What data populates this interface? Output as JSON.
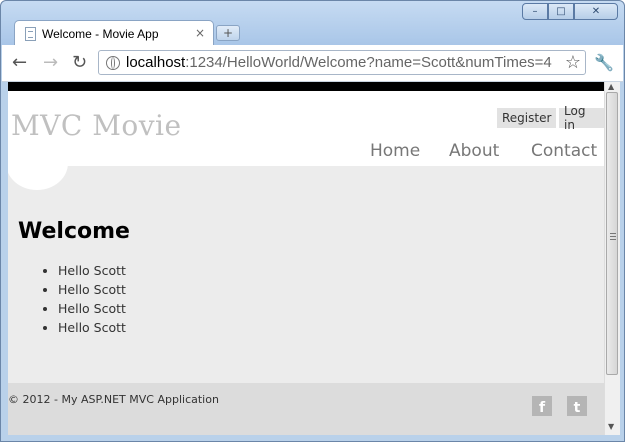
{
  "browser": {
    "tab_title": "Welcome - Movie App",
    "tab_close": "×",
    "new_tab": "+",
    "url_host": "localhost",
    "url_path": ":1234/HelloWorld/Welcome?name=Scott&numTimes=4"
  },
  "header": {
    "site_title": "MVC Movie",
    "register_label": "Register",
    "login_label": "Log in",
    "menu": [
      "Home",
      "About",
      "Contact"
    ]
  },
  "main": {
    "heading": "Welcome",
    "greetings": [
      "Hello Scott",
      "Hello Scott",
      "Hello Scott",
      "Hello Scott"
    ]
  },
  "footer": {
    "copyright": "© 2012 - My ASP.NET MVC Application",
    "facebook_letter": "f",
    "twitter_letter": "t"
  },
  "colors": {
    "page_background": "#ececec",
    "footer_background": "#dcdcdc",
    "menu_text": "#777777",
    "site_title": "#c0c0c0"
  },
  "icons": [
    "page-icon",
    "back-icon",
    "forward-icon",
    "reload-icon",
    "globe-icon",
    "star-icon",
    "wrench-icon",
    "facebook-icon",
    "twitter-icon"
  ]
}
